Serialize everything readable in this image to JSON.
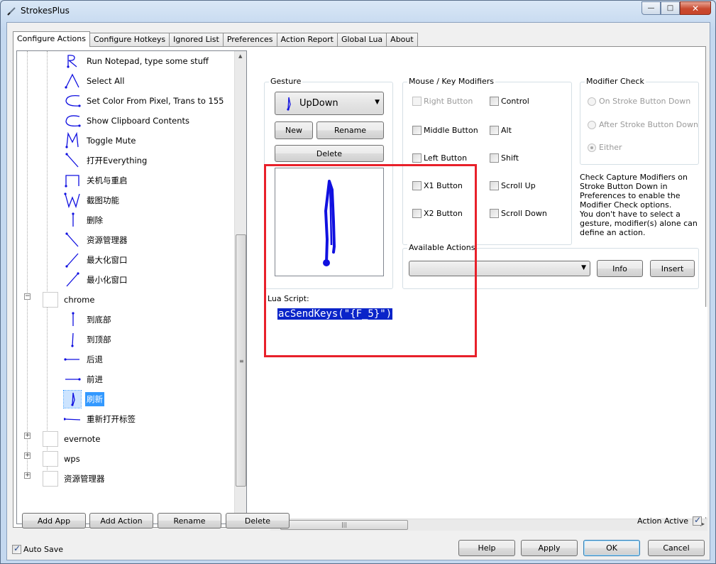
{
  "window": {
    "title": "StrokesPlus",
    "minimize": "—",
    "maximize": "□",
    "close": "✕"
  },
  "tabs": [
    "Configure Actions",
    "Configure Hotkeys",
    "Ignored List",
    "Preferences",
    "Action Report",
    "Global Lua",
    "About"
  ],
  "tree": {
    "actions_before": [
      "Run Notepad, type some stuff",
      "Select All",
      "Set Color From Pixel, Trans to 155",
      "Show Clipboard Contents",
      "Toggle Mute",
      "打开Everything",
      "关机与重启",
      "截图功能",
      "删除",
      "资源管理器",
      "最大化窗口",
      "最小化窗口"
    ],
    "chrome_app": "chrome",
    "chrome_actions": [
      "到底部",
      "到顶部",
      "后退",
      "前进",
      "刷新",
      "重新打开标签"
    ],
    "selected": "刷新",
    "apps_after": [
      "evernote",
      "wps",
      "资源管理器"
    ]
  },
  "gesture": {
    "group_label": "Gesture",
    "selected": "UpDown",
    "new_label": "New",
    "rename_label": "Rename",
    "delete_label": "Delete"
  },
  "modifiers": {
    "group_label": "Mouse / Key Modifiers",
    "mouse": [
      {
        "label": "Right Button",
        "checked": false,
        "disabled": true
      },
      {
        "label": "Middle Button",
        "checked": false,
        "disabled": false
      },
      {
        "label": "Left Button",
        "checked": false,
        "disabled": false
      },
      {
        "label": "X1 Button",
        "checked": false,
        "disabled": false
      },
      {
        "label": "X2 Button",
        "checked": false,
        "disabled": false
      }
    ],
    "keys": [
      {
        "label": "Control",
        "checked": false
      },
      {
        "label": "Alt",
        "checked": false
      },
      {
        "label": "Shift",
        "checked": false
      },
      {
        "label": "Scroll Up",
        "checked": false
      },
      {
        "label": "Scroll Down",
        "checked": false
      }
    ]
  },
  "modifier_check": {
    "group_label": "Modifier Check",
    "options": [
      "On Stroke Button Down",
      "After Stroke Button Down",
      "Either"
    ],
    "selected": "Either",
    "note1": "Check Capture Modifiers on Stroke Button Down in Preferences to enable the Modifier Check options.",
    "note2": "You don't have to select a gesture, modifier(s) alone can define an action."
  },
  "available_actions": {
    "group_label": "Available Actions",
    "value": "",
    "info_label": "Info",
    "insert_label": "Insert"
  },
  "lua": {
    "label": "Lua Script:",
    "code": "acSendKeys(\"{F_5}\")"
  },
  "bottom": {
    "add_app": "Add App",
    "add_action": "Add Action",
    "rename": "Rename",
    "delete": "Delete",
    "action_active_label": "Action Active",
    "action_active": true,
    "auto_save_label": "Auto Save",
    "auto_save": true,
    "help": "Help",
    "apply": "Apply",
    "ok": "OK",
    "cancel": "Cancel"
  },
  "colors": {
    "highlight_box": "#e8202a",
    "gesture_stroke": "#1010e0",
    "selection": "#3399ff"
  }
}
